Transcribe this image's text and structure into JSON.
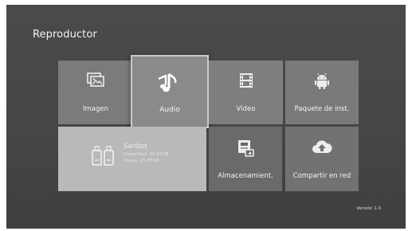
{
  "header": {
    "title": "Reproductor"
  },
  "tiles": {
    "imagen": {
      "label": "Imagen",
      "icon": "image-gallery-icon"
    },
    "audio": {
      "label": "Audio",
      "icon": "music-note-icon"
    },
    "video": {
      "label": "Vídeo",
      "icon": "film-icon"
    },
    "paquete": {
      "label": "Paquete de inst.",
      "icon": "android-icon"
    },
    "sanbot": {
      "name": "Sanbot",
      "line1": "Capacidad: 32.07GB",
      "line2": "Usado: 25.36GB",
      "icon": "storage-devices-icon"
    },
    "almacenamiento": {
      "label": "Almacenamient.",
      "icon": "storage-transfer-icon"
    },
    "compartir": {
      "label": "Compartir en red",
      "icon": "cloud-upload-icon"
    }
  },
  "footer": {
    "version": "Versión 1.0"
  },
  "colors": {
    "background": "#464646",
    "tile": "#777777",
    "selected_border": "#c9c9c9",
    "text": "#f3f3f3"
  }
}
